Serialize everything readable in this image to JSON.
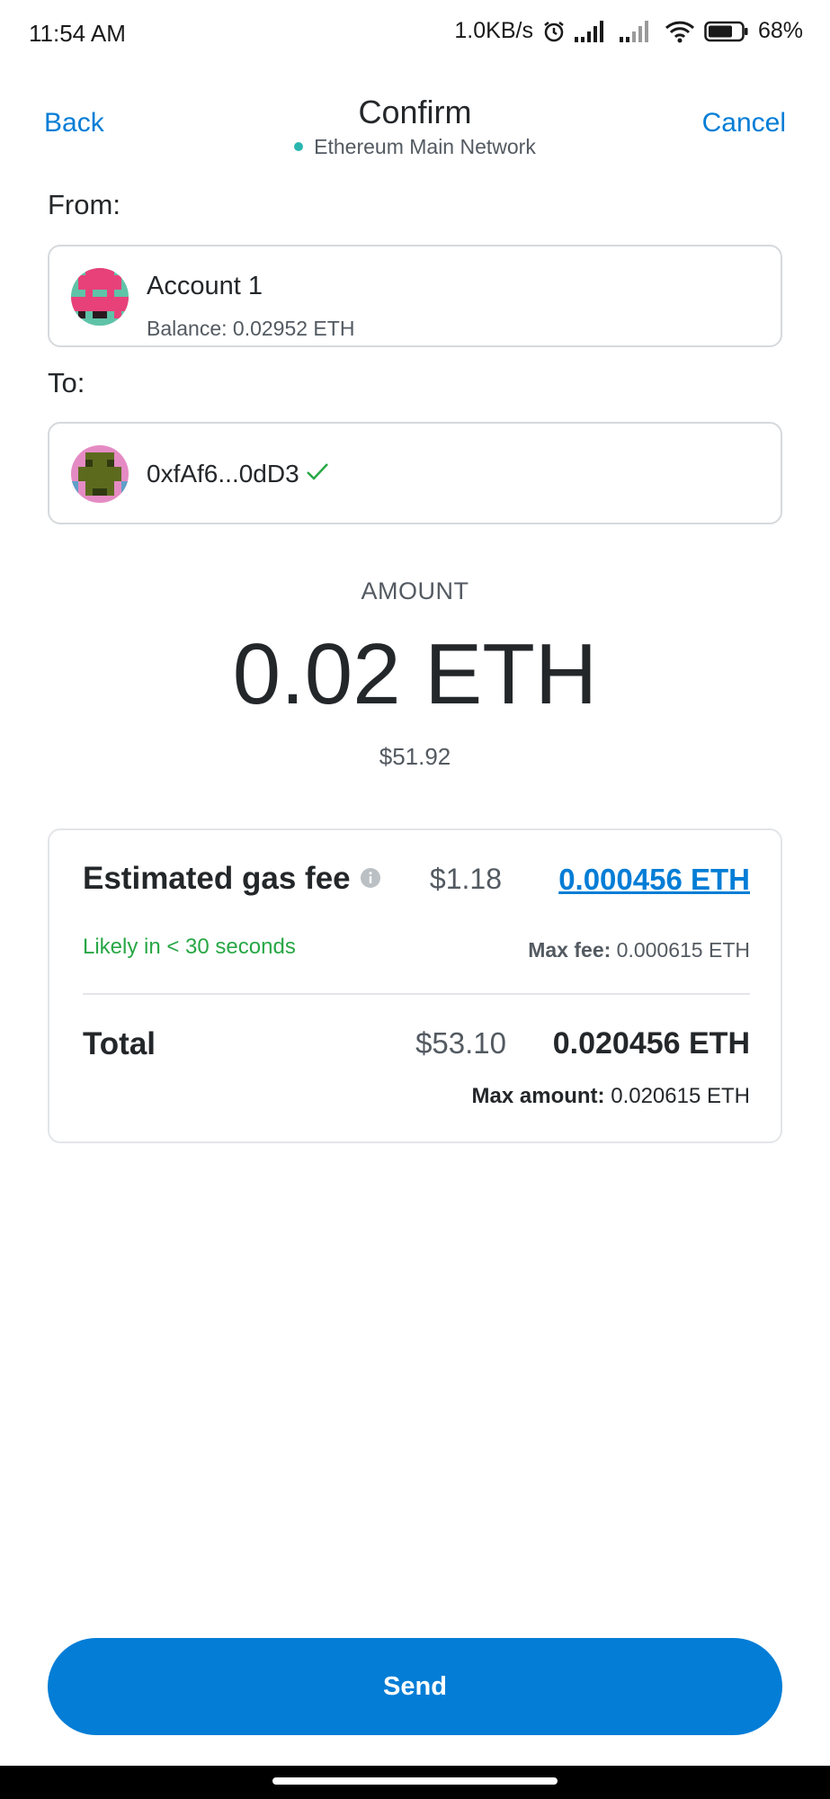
{
  "status": {
    "time": "11:54 AM",
    "speed": "1.0KB/s",
    "battery": "68%"
  },
  "header": {
    "back": "Back",
    "title": "Confirm",
    "network": "Ethereum Main Network",
    "cancel": "Cancel"
  },
  "from": {
    "label": "From:",
    "account_name": "Account 1",
    "balance": "Balance: 0.02952 ETH"
  },
  "to": {
    "label": "To:",
    "address": "0xfAf6...0dD3"
  },
  "amount": {
    "label": "AMOUNT",
    "value": "0.02 ETH",
    "fiat": "$51.92"
  },
  "fee": {
    "title": "Estimated gas fee",
    "fiat": "$1.18",
    "eth": "0.000456 ETH",
    "likely": "Likely in < 30 seconds",
    "max_fee_label": "Max fee:",
    "max_fee_value": "0.000615 ETH"
  },
  "total": {
    "label": "Total",
    "fiat": "$53.10",
    "eth": "0.020456 ETH",
    "max_amount_label": "Max amount:",
    "max_amount_value": "0.020615 ETH"
  },
  "send_button": "Send",
  "colors": {
    "accent": "#037dd6",
    "success": "#28a745",
    "network_dot": "#29b6af"
  }
}
